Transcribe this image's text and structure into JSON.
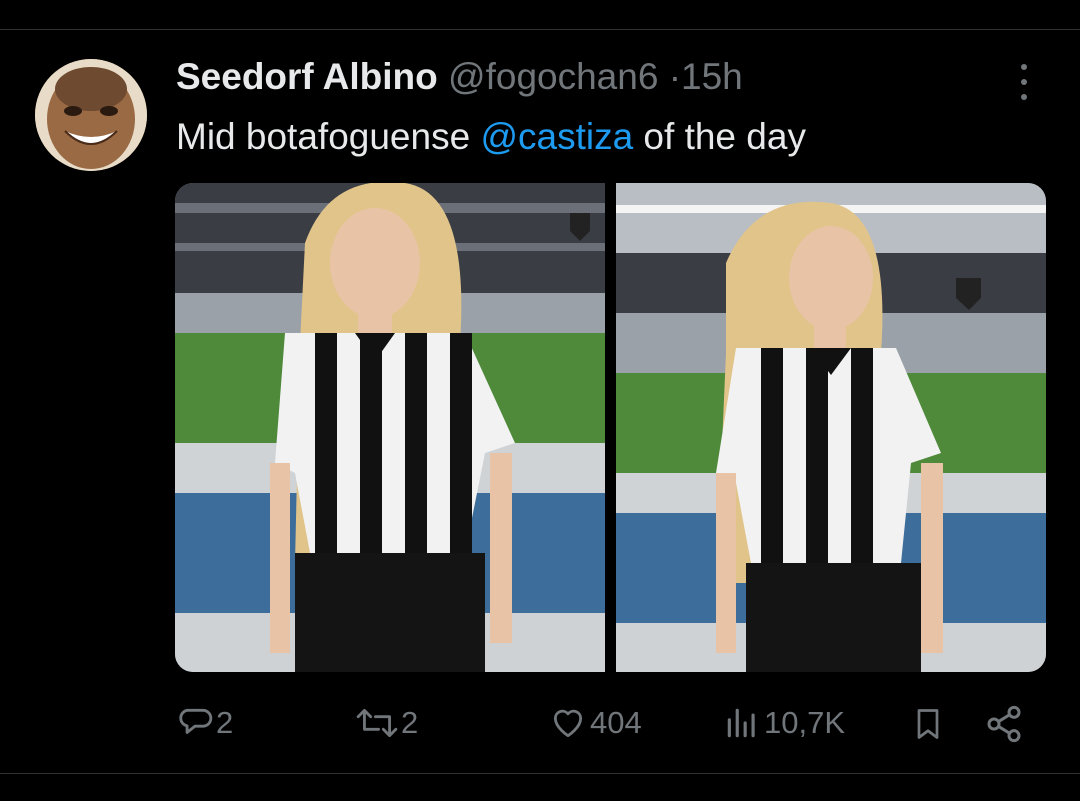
{
  "tweet": {
    "author_name": "Seedorf Albino",
    "author_handle": "@fogochan6",
    "separator": "·",
    "time": "15h",
    "text_before": "Mid botafoguense ",
    "mention": "@castiza",
    "text_after": " of the day"
  },
  "media": {
    "images": [
      {
        "description": "woman in black and white striped Botafogo jersey in stadium, facing camera"
      },
      {
        "description": "woman in black and white striped Botafogo jersey in stadium, looking to the side"
      }
    ]
  },
  "actions": {
    "replies": "2",
    "retweets": "2",
    "likes": "404",
    "views": "10,7K"
  },
  "icons": [
    "reply-icon",
    "retweet-icon",
    "like-icon",
    "views-icon",
    "bookmark-icon",
    "share-icon",
    "more-icon"
  ],
  "colors": {
    "background": "#000000",
    "text": "#e7e9ea",
    "muted": "#71767b",
    "link": "#1d9bf0",
    "divider": "#2f3336"
  }
}
